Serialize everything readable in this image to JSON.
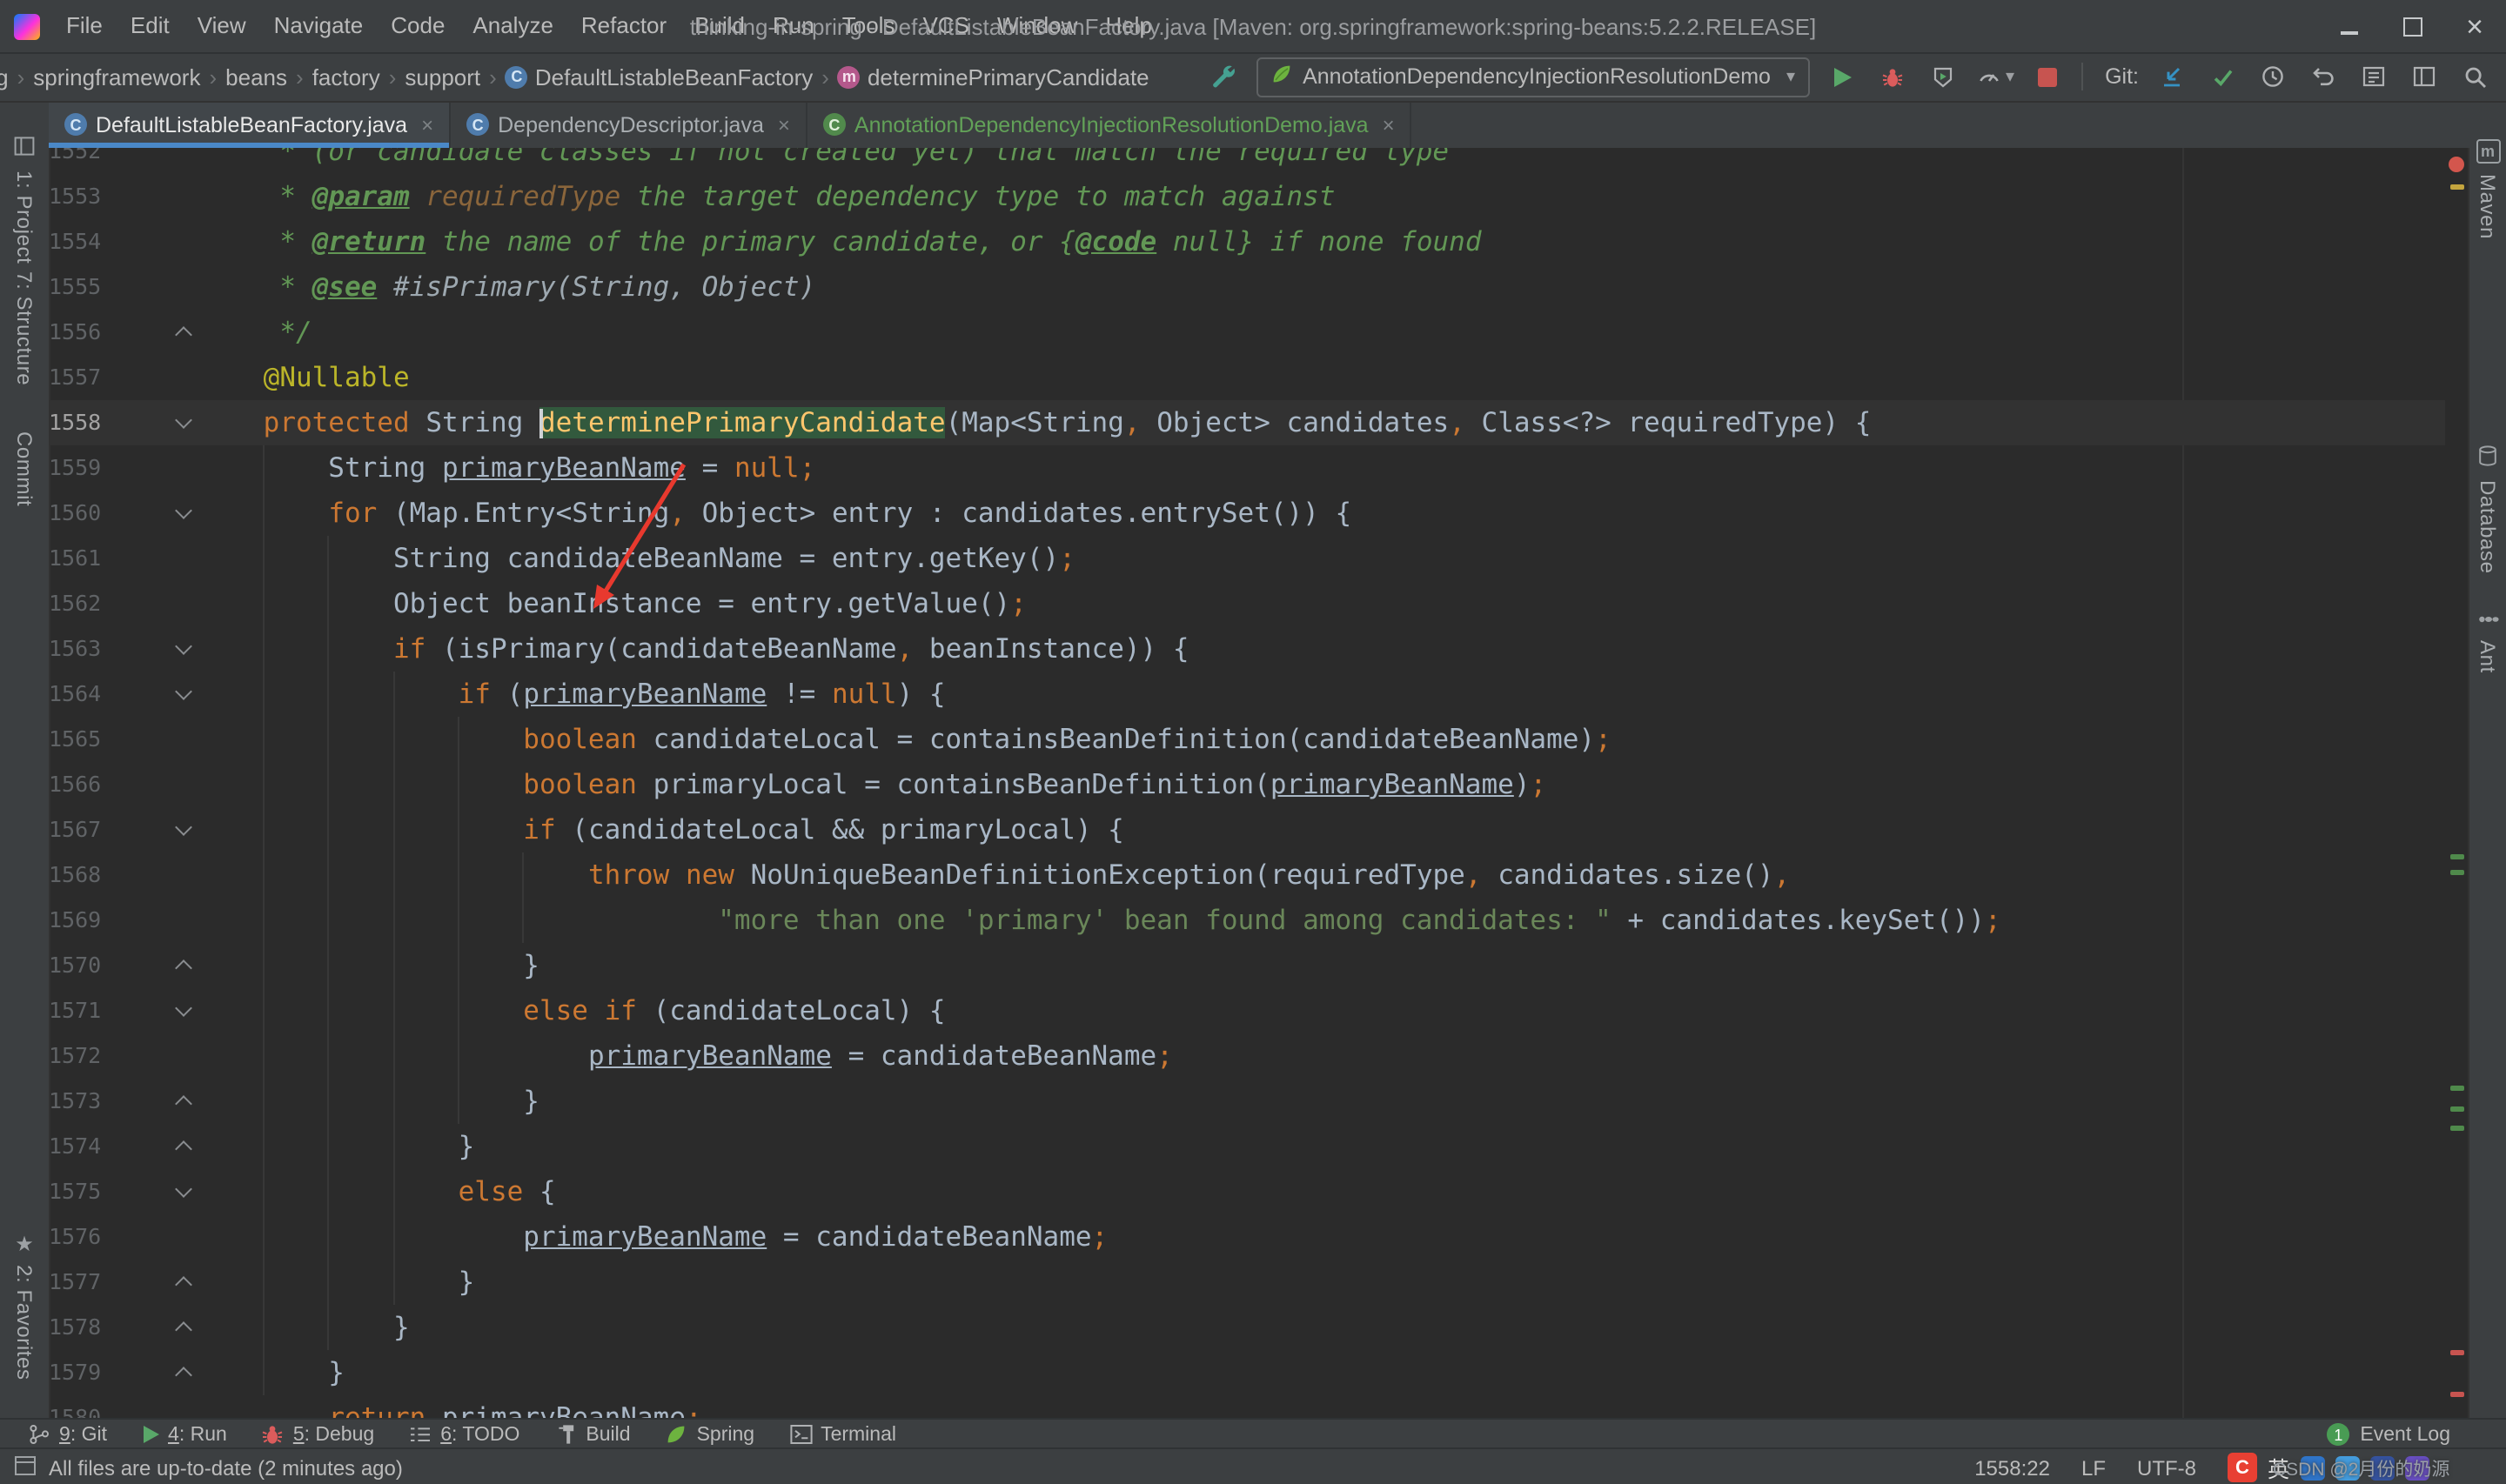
{
  "colors": {
    "editor_bg": "#2b2b2b",
    "panel_bg": "#3c3f41",
    "keyword": "#cc7832",
    "string": "#6a8759",
    "comment": "#629755",
    "doc_tag_value": "#8a653b",
    "annotation": "#bbb529",
    "method_declaration": "#ffc66d",
    "default_text": "#a9b7c6",
    "line_number": "#606366",
    "active_tab_underline": "#4a88c7",
    "run_green": "#59a869",
    "stop_red": "#c75450",
    "added_file_green": "#62a158",
    "identifier_highlight_bg": "#32593d",
    "annotation_arrow_red": "#e8392e"
  },
  "title_bar": {
    "title": "thinking-in-spring - DefaultListableBeanFactory.java [Maven: org.springframework:spring-beans:5.2.2.RELEASE]",
    "menus": [
      "File",
      "Edit",
      "View",
      "Navigate",
      "Code",
      "Analyze",
      "Refactor",
      "Build",
      "Run",
      "Tools",
      "VCS",
      "Window",
      "Help"
    ]
  },
  "nav_bar": {
    "breadcrumbs": [
      {
        "label": "org"
      },
      {
        "label": "springframework"
      },
      {
        "label": "beans"
      },
      {
        "label": "factory"
      },
      {
        "label": "support"
      },
      {
        "label": "DefaultListableBeanFactory",
        "icon": "class"
      },
      {
        "label": "determinePrimaryCandidate",
        "icon": "method"
      }
    ],
    "run_config": "AnnotationDependencyInjectionResolutionDemo",
    "git_label": "Git:"
  },
  "tabs": [
    {
      "label": "DefaultListableBeanFactory.java",
      "active": true
    },
    {
      "label": "DependencyDescriptor.java"
    },
    {
      "label": "AnnotationDependencyInjectionResolutionDemo.java",
      "added": true
    }
  ],
  "left_stripe": {
    "project": "1: Project",
    "structure": "7: Structure",
    "commit": "Commit",
    "favorites": "2: Favorites"
  },
  "right_stripe": {
    "maven": "Maven",
    "database": "Database",
    "ant": "Ant"
  },
  "editor": {
    "lines": [
      {
        "n": 1552,
        "seg": [
          [
            "doc",
            "     * (or candidate classes if not created yet) that match the required type"
          ]
        ]
      },
      {
        "n": 1553,
        "seg": [
          [
            "doc",
            "     * "
          ],
          [
            "doctag",
            "@param"
          ],
          [
            "docval",
            " requiredType"
          ],
          [
            "doc",
            " the target dependency type to match against"
          ]
        ]
      },
      {
        "n": 1554,
        "seg": [
          [
            "doc",
            "     * "
          ],
          [
            "doctag",
            "@return"
          ],
          [
            "doc",
            " the name of the primary candidate, or {"
          ],
          [
            "doctag",
            "@code"
          ],
          [
            "doc",
            " null} if none found"
          ]
        ]
      },
      {
        "n": 1555,
        "seg": [
          [
            "doc",
            "     * "
          ],
          [
            "doctag",
            "@see"
          ],
          [
            "docref",
            " #isPrimary(String, Object)"
          ]
        ]
      },
      {
        "n": 1556,
        "fold": "u",
        "seg": [
          [
            "doc",
            "     */"
          ]
        ]
      },
      {
        "n": 1557,
        "seg": [
          [
            "txt",
            "    "
          ],
          [
            "ann",
            "@Nullable"
          ]
        ]
      },
      {
        "n": 1558,
        "cur": true,
        "fold": "d",
        "seg": [
          [
            "txt",
            "    "
          ],
          [
            "kw",
            "protected"
          ],
          [
            "txt",
            " String "
          ],
          [
            "caret",
            ""
          ],
          [
            "mdecl",
            "determinePrimaryCandidate"
          ],
          [
            "txt",
            "(Map<String"
          ],
          [
            "kw",
            ","
          ],
          [
            "txt",
            " Object> candidates"
          ],
          [
            "kw",
            ","
          ],
          [
            "txt",
            " Class<?> requiredType) {"
          ]
        ]
      },
      {
        "n": 1559,
        "seg": [
          [
            "txt",
            "        String "
          ],
          [
            "und",
            "primaryBeanName"
          ],
          [
            "txt",
            " = "
          ],
          [
            "kw",
            "null"
          ],
          [
            "kw",
            ";"
          ]
        ]
      },
      {
        "n": 1560,
        "fold": "d",
        "seg": [
          [
            "txt",
            "        "
          ],
          [
            "kw",
            "for"
          ],
          [
            "txt",
            " (Map.Entry<String"
          ],
          [
            "kw",
            ","
          ],
          [
            "txt",
            " Object> entry : candidates.entrySet()) {"
          ]
        ]
      },
      {
        "n": 1561,
        "seg": [
          [
            "txt",
            "            String candidateBeanName = entry.getKey()"
          ],
          [
            "kw",
            ";"
          ]
        ]
      },
      {
        "n": 1562,
        "seg": [
          [
            "txt",
            "            Object beanInstance = entry.getValue()"
          ],
          [
            "kw",
            ";"
          ]
        ]
      },
      {
        "n": 1563,
        "fold": "d",
        "seg": [
          [
            "txt",
            "            "
          ],
          [
            "kw",
            "if"
          ],
          [
            "txt",
            " (isPrimary(candidateBeanName"
          ],
          [
            "kw",
            ","
          ],
          [
            "txt",
            " beanInstance)) {"
          ]
        ]
      },
      {
        "n": 1564,
        "fold": "d",
        "seg": [
          [
            "txt",
            "                "
          ],
          [
            "kw",
            "if"
          ],
          [
            "txt",
            " ("
          ],
          [
            "und",
            "primaryBeanName"
          ],
          [
            "txt",
            " != "
          ],
          [
            "kw",
            "null"
          ],
          [
            "txt",
            ") {"
          ]
        ]
      },
      {
        "n": 1565,
        "seg": [
          [
            "txt",
            "                    "
          ],
          [
            "kw",
            "boolean"
          ],
          [
            "txt",
            " candidateLocal = containsBeanDefinition(candidateBeanName)"
          ],
          [
            "kw",
            ";"
          ]
        ]
      },
      {
        "n": 1566,
        "seg": [
          [
            "txt",
            "                    "
          ],
          [
            "kw",
            "boolean"
          ],
          [
            "txt",
            " primaryLocal = containsBeanDefinition("
          ],
          [
            "und",
            "primaryBeanName"
          ],
          [
            "txt",
            ")"
          ],
          [
            "kw",
            ";"
          ]
        ]
      },
      {
        "n": 1567,
        "fold": "d",
        "seg": [
          [
            "txt",
            "                    "
          ],
          [
            "kw",
            "if"
          ],
          [
            "txt",
            " (candidateLocal && primaryLocal) {"
          ]
        ]
      },
      {
        "n": 1568,
        "seg": [
          [
            "txt",
            "                        "
          ],
          [
            "kw",
            "throw"
          ],
          [
            "txt",
            " "
          ],
          [
            "kw",
            "new"
          ],
          [
            "txt",
            " NoUniqueBeanDefinitionException(requiredType"
          ],
          [
            "kw",
            ","
          ],
          [
            "txt",
            " candidates.size()"
          ],
          [
            "kw",
            ","
          ]
        ]
      },
      {
        "n": 1569,
        "seg": [
          [
            "txt",
            "                                "
          ],
          [
            "str",
            "\"more than one 'primary' bean found among candidates: \""
          ],
          [
            "txt",
            " + candidates.keySet())"
          ],
          [
            "kw",
            ";"
          ]
        ]
      },
      {
        "n": 1570,
        "fold": "u",
        "seg": [
          [
            "txt",
            "                    }"
          ]
        ]
      },
      {
        "n": 1571,
        "fold": "d",
        "seg": [
          [
            "txt",
            "                    "
          ],
          [
            "kw",
            "else if"
          ],
          [
            "txt",
            " (candidateLocal) {"
          ]
        ]
      },
      {
        "n": 1572,
        "seg": [
          [
            "txt",
            "                        "
          ],
          [
            "und",
            "primaryBeanName"
          ],
          [
            "txt",
            " = candidateBeanName"
          ],
          [
            "kw",
            ";"
          ]
        ]
      },
      {
        "n": 1573,
        "fold": "u",
        "seg": [
          [
            "txt",
            "                    }"
          ]
        ]
      },
      {
        "n": 1574,
        "fold": "u",
        "seg": [
          [
            "txt",
            "                }"
          ]
        ]
      },
      {
        "n": 1575,
        "fold": "d",
        "seg": [
          [
            "txt",
            "                "
          ],
          [
            "kw",
            "else"
          ],
          [
            "txt",
            " {"
          ]
        ]
      },
      {
        "n": 1576,
        "seg": [
          [
            "txt",
            "                    "
          ],
          [
            "und",
            "primaryBeanName"
          ],
          [
            "txt",
            " = candidateBeanName"
          ],
          [
            "kw",
            ";"
          ]
        ]
      },
      {
        "n": 1577,
        "fold": "u",
        "seg": [
          [
            "txt",
            "                }"
          ]
        ]
      },
      {
        "n": 1578,
        "fold": "u",
        "seg": [
          [
            "txt",
            "            }"
          ]
        ]
      },
      {
        "n": 1579,
        "fold": "u",
        "seg": [
          [
            "txt",
            "        }"
          ]
        ]
      },
      {
        "n": 1580,
        "seg": [
          [
            "txt",
            "        "
          ],
          [
            "kw",
            "return"
          ],
          [
            "txt",
            " "
          ],
          [
            "und",
            "primaryBeanName"
          ],
          [
            "kw",
            ";"
          ]
        ]
      }
    ]
  },
  "bottom_bar": {
    "items": [
      {
        "icon": "git",
        "label": "9: Git"
      },
      {
        "icon": "run",
        "label": "4: Run"
      },
      {
        "icon": "debug",
        "label": "5: Debug"
      },
      {
        "icon": "todo",
        "label": "6: TODO"
      },
      {
        "icon": "build",
        "label": "Build"
      },
      {
        "icon": "spring",
        "label": "Spring"
      },
      {
        "icon": "terminal",
        "label": "Terminal"
      }
    ],
    "event_count": "1",
    "event_log_label": "Event Log"
  },
  "status_bar": {
    "message": "All files are up-to-date (2 minutes ago)",
    "caret_position": "1558:22",
    "line_separator": "LF",
    "encoding": "UTF-8",
    "ime": "英",
    "watermark": "CSDN @2月份的奶源"
  }
}
